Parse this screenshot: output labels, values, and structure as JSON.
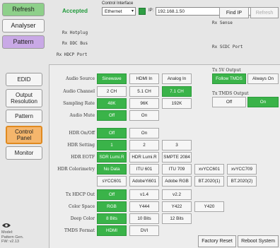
{
  "header": {
    "refresh_label": "Refresh",
    "accepted_label": "Accepted",
    "iface_title": "Control Interface",
    "iface_value": "Ethernet",
    "ip_label": "IP:",
    "ip_value": "192.168.1.50",
    "find_ip_label": "Find IP",
    "refresh_small_label": "Refresh"
  },
  "sidebar": {
    "analyser": "Analyser",
    "pattern": "Pattern",
    "edid": "EDID",
    "output_res": "Output Resolution",
    "pattern2": "Pattern",
    "control_panel": "Control Panel",
    "monitor": "Monitor"
  },
  "status": {
    "rx_hotplug": "Rx Hotplug",
    "rx_ddc_bus": "Rx DDC Bus",
    "rx_hdcp_port": "Rx HDCP Port",
    "rx_sense": "Rx Sense",
    "rx_scdc_port": "Rx SCDC Port"
  },
  "audio": {
    "source_label": "Audio Source",
    "source_options": [
      "Sinewave",
      "HDMI In",
      "Analog In"
    ],
    "channel_label": "Audio Channel",
    "channel_options": [
      "2 CH",
      "5.1 CH",
      "7.1 CH"
    ],
    "rate_label": "Sampling Rate",
    "rate_options": [
      "48K",
      "96K",
      "192K"
    ],
    "mute_label": "Audio Mute",
    "mute_options": [
      "Off",
      "On"
    ]
  },
  "tx5v": {
    "title": "Tx 5V Output",
    "options": [
      "Follow TMDS",
      "Always On"
    ]
  },
  "txtmds": {
    "title": "Tx TMDS Output",
    "options": [
      "Off",
      "On"
    ]
  },
  "hdr": {
    "onoff_label": "HDR On/Off",
    "onoff_options": [
      "Off",
      "On"
    ],
    "setting_label": "HDR Setting",
    "setting_options": [
      "1",
      "2",
      "3"
    ],
    "eotf_label": "HDR EOTF",
    "eotf_options": [
      "SDR Lumi.R",
      "HDR Lumi.R",
      "SMPTE 2084"
    ],
    "color_label": "HDR Colorimetry",
    "color_row1": [
      "No Data",
      "ITU 601",
      "ITU 709",
      "xvYCC601",
      "xvYCC709"
    ],
    "color_row2": [
      "sYCC601",
      "AdobeYi601",
      "Adobe RGB",
      "BT.2020(1)",
      "BT.2020(2)"
    ]
  },
  "tx": {
    "hdcp_label": "Tx HDCP Out",
    "hdcp_options": [
      "Off",
      "v1.4",
      "v2.2"
    ],
    "space_label": "Color Space",
    "space_options": [
      "RGB",
      "Y444",
      "Y422",
      "Y420"
    ],
    "deep_label": "Deep Color",
    "deep_options": [
      "8 Bits",
      "10 Bits",
      "12 Bits"
    ],
    "tmds_label": "TMDS Format",
    "tmds_options": [
      "HDMI",
      "DVI"
    ]
  },
  "footer": {
    "factory_reset": "Factory Reset",
    "reboot": "Reboot System",
    "model_label": "Model:",
    "model_value": "Pattern Gen.",
    "fw_label": "FW: v2.13"
  },
  "colors": {
    "selected": "#3ab349",
    "accent": "#1f9a3a"
  }
}
